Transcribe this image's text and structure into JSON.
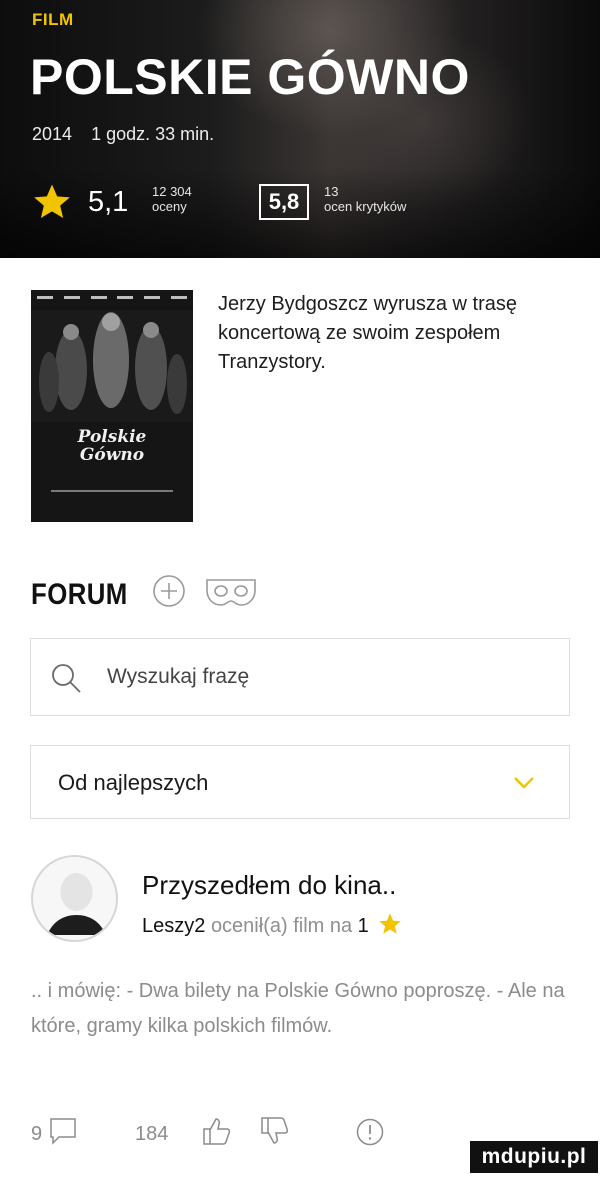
{
  "hero": {
    "category_label": "FILM",
    "title": "POLSKIE GÓWNO",
    "year": "2014",
    "duration": "1 godz. 33 min.",
    "rating": "5,1",
    "votes_count": "12 304",
    "votes_label": "oceny",
    "critics_rating": "5,8",
    "critics_count": "13",
    "critics_label": "ocen krytyków",
    "accent_color": "#f2c400"
  },
  "poster": {
    "logo_line1": "Polskie",
    "logo_line2": "Gówno"
  },
  "description": "Jerzy Bydgoszcz wyrusza w trasę koncertową ze swoim zespołem Tranzystory.",
  "forum": {
    "heading": "FORUM",
    "search_placeholder": "Wyszukaj frazę",
    "sort_selected": "Od najlepszych"
  },
  "post": {
    "title": "Przyszedłem do kina..",
    "author": "Leszy2",
    "rated_text": "ocenił(a) film na",
    "rated_value": "1",
    "body": ".. i mówię: - Dwa bilety na Polskie Gówno poproszę. - Ale na które, gramy kilka polskich filmów.",
    "comments_count": "9",
    "likes_count": "184"
  },
  "icons": [
    "star-icon",
    "plus-circle-icon",
    "mask-icon",
    "search-icon",
    "chevron-down-icon",
    "avatar-icon",
    "comment-icon",
    "thumbs-up-icon",
    "thumbs-down-icon",
    "report-icon"
  ],
  "watermark": "mdupiu.pl"
}
